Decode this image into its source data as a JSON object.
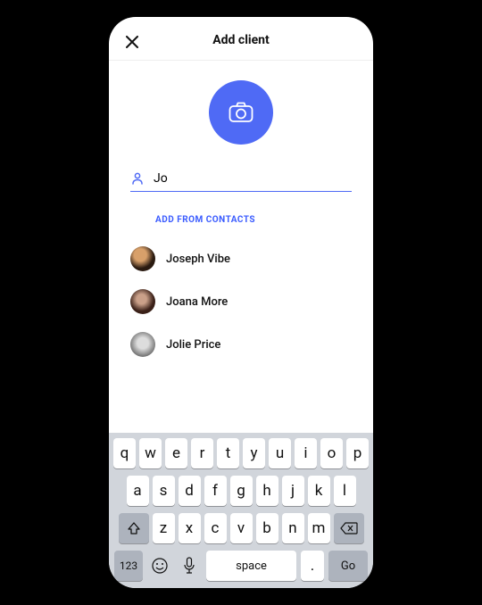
{
  "header": {
    "title": "Add client"
  },
  "input": {
    "value": "Jo"
  },
  "section_label": "ADD FROM CONTACTS",
  "contacts": [
    {
      "name": "Joseph Vibe"
    },
    {
      "name": "Joana More"
    },
    {
      "name": "Jolie Price"
    }
  ],
  "keyboard": {
    "row1": [
      "q",
      "w",
      "e",
      "r",
      "t",
      "y",
      "u",
      "i",
      "o",
      "p"
    ],
    "row2": [
      "a",
      "s",
      "d",
      "f",
      "g",
      "h",
      "j",
      "k",
      "l"
    ],
    "row3": [
      "z",
      "x",
      "c",
      "v",
      "b",
      "n",
      "m"
    ],
    "fn123": "123",
    "space": "space",
    "dot": ".",
    "go": "Go"
  }
}
